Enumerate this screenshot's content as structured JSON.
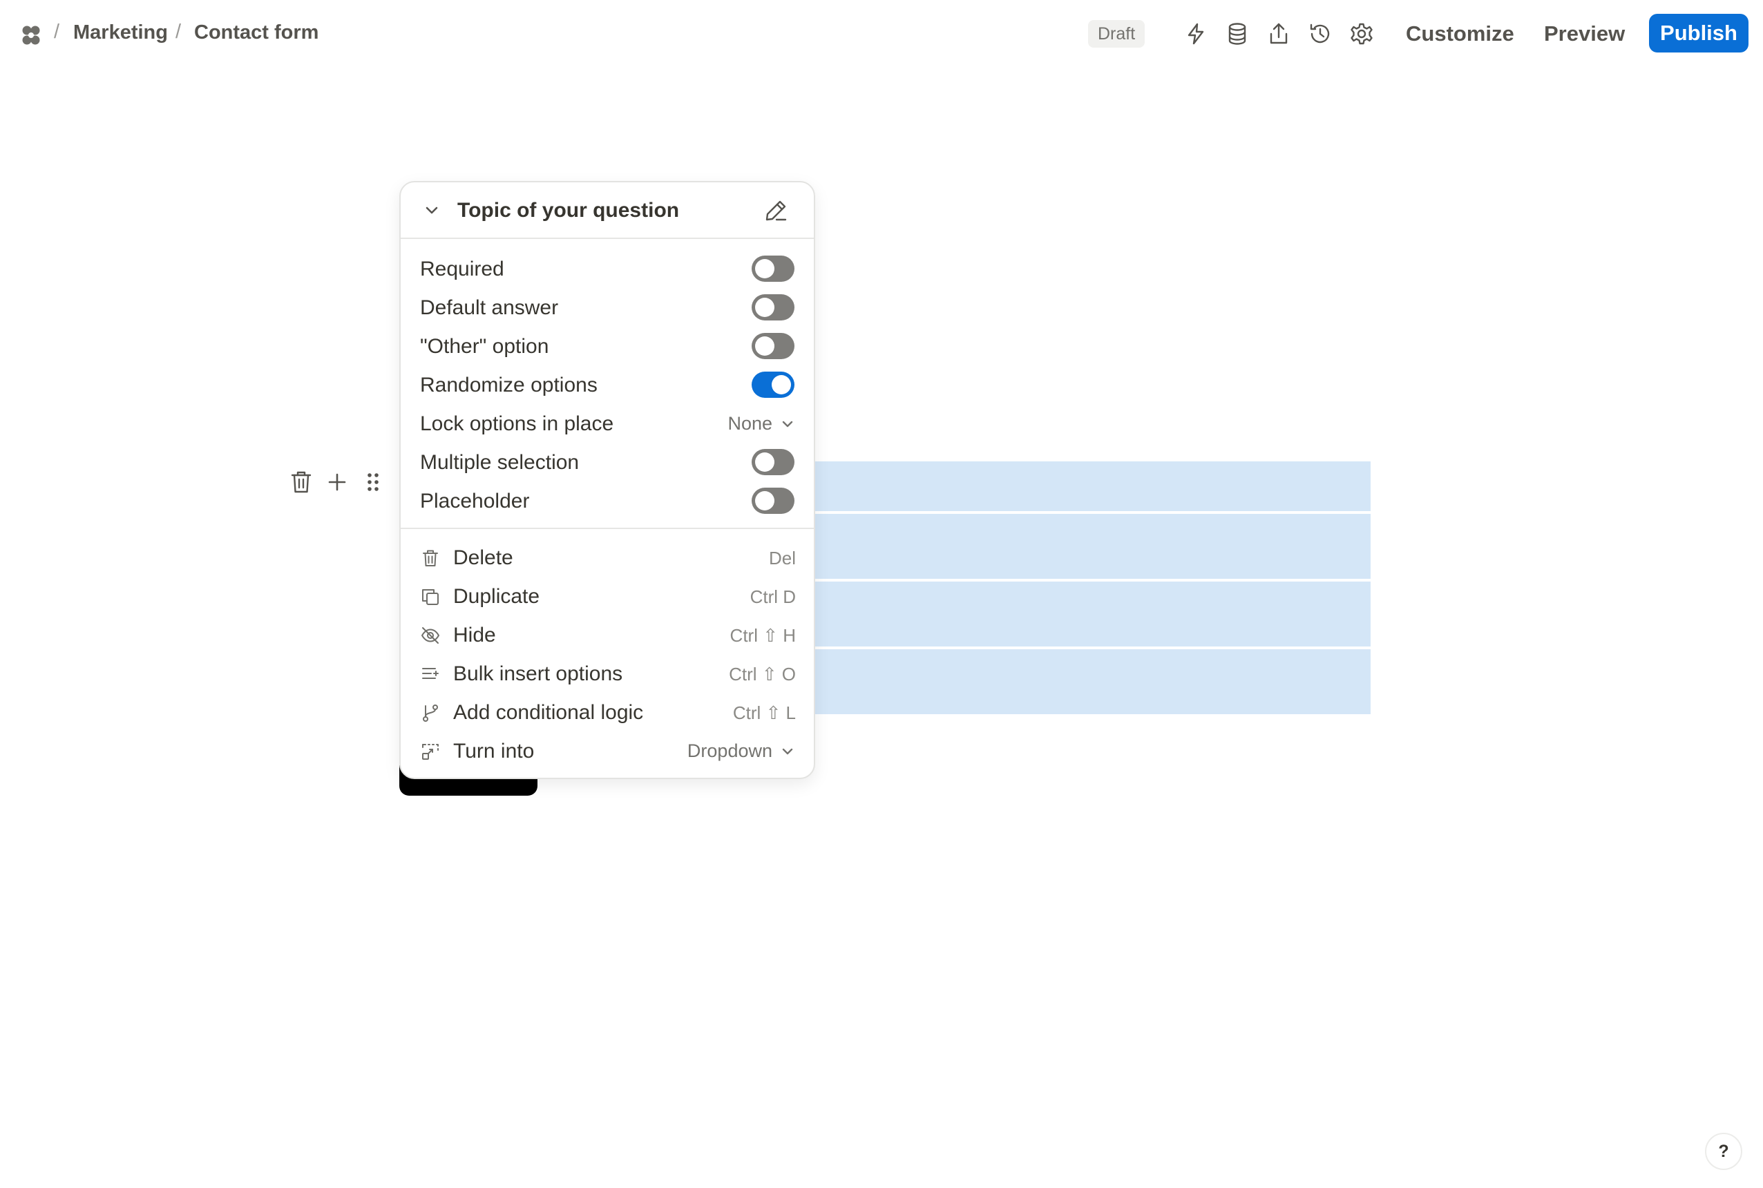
{
  "breadcrumb": {
    "separator": "/",
    "workspace": "Marketing",
    "form": "Contact form"
  },
  "header": {
    "status_badge": "Draft",
    "icons": [
      "lightning-icon",
      "database-icon",
      "share-icon",
      "history-icon",
      "settings-icon"
    ],
    "customize_label": "Customize",
    "preview_label": "Preview",
    "publish_label": "Publish"
  },
  "colors": {
    "accent": "#0a6fd6",
    "option_highlight": "#d4e6f7"
  },
  "menu": {
    "title": "Topic of your question",
    "settings": [
      {
        "label": "Required",
        "type": "toggle",
        "on": false
      },
      {
        "label": "Default answer",
        "type": "toggle",
        "on": false
      },
      {
        "label": "\"Other\" option",
        "type": "toggle",
        "on": false
      },
      {
        "label": "Randomize options",
        "type": "toggle",
        "on": true
      },
      {
        "label": "Lock options in place",
        "type": "select",
        "value": "None"
      },
      {
        "label": "Multiple selection",
        "type": "toggle",
        "on": false
      },
      {
        "label": "Placeholder",
        "type": "toggle",
        "on": false
      }
    ],
    "actions": [
      {
        "label": "Delete",
        "shortcut": "Del",
        "icon": "trash-icon"
      },
      {
        "label": "Duplicate",
        "shortcut": "Ctrl D",
        "icon": "duplicate-icon"
      },
      {
        "label": "Hide",
        "shortcut": "Ctrl ⇧ H",
        "icon": "eye-off-icon"
      },
      {
        "label": "Bulk insert options",
        "shortcut": "Ctrl ⇧ O",
        "icon": "bulk-insert-icon"
      },
      {
        "label": "Add conditional logic",
        "shortcut": "Ctrl ⇧ L",
        "icon": "branch-icon"
      },
      {
        "label": "Turn into",
        "shortcut": "Dropdown",
        "icon": "turn-into-icon"
      }
    ]
  },
  "help_label": "?"
}
